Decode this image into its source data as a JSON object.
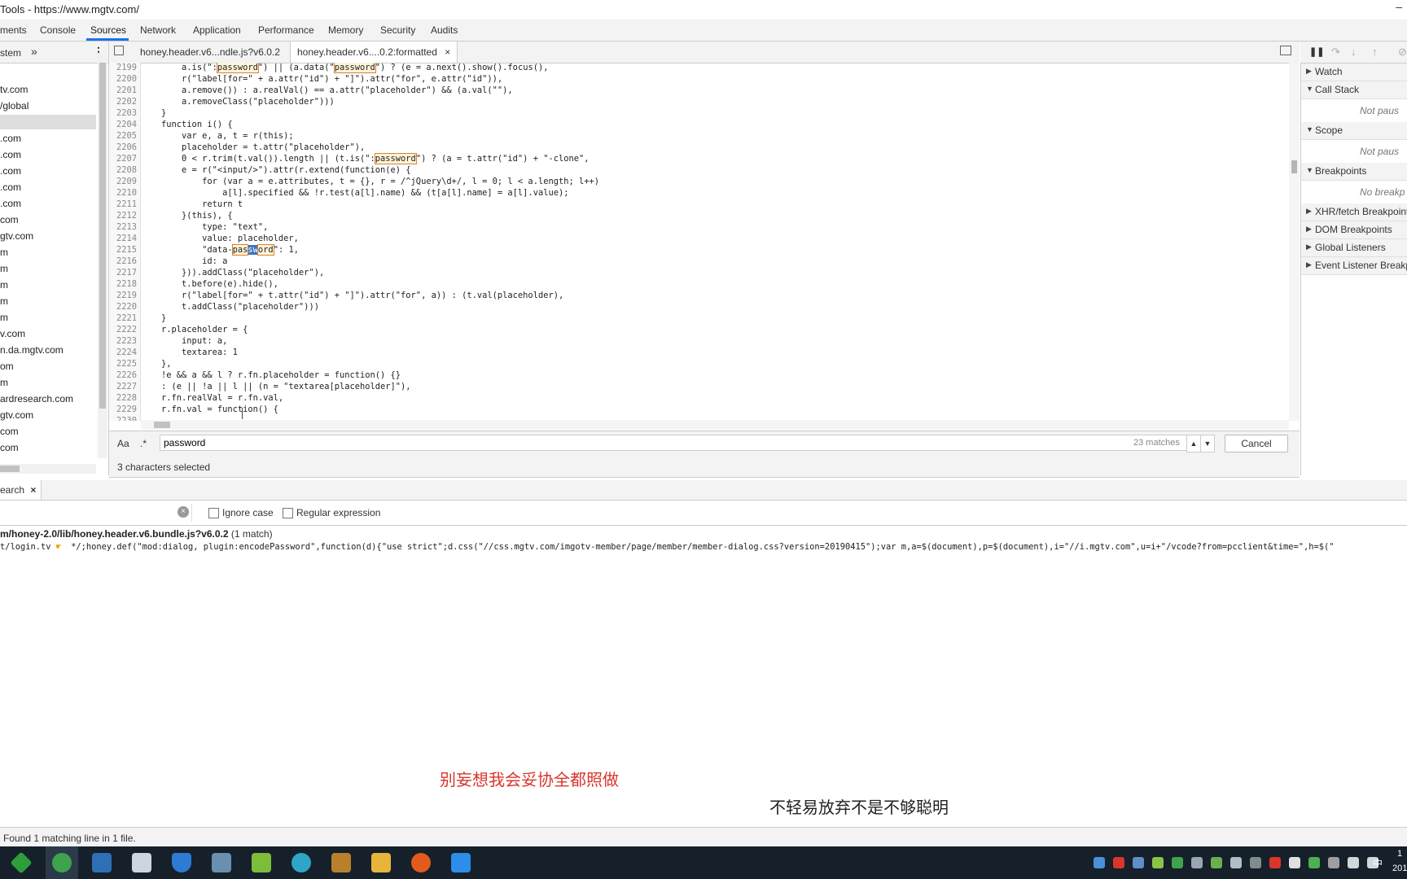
{
  "window": {
    "title": "Tools - https://www.mgtv.com/"
  },
  "panel_tabs": [
    {
      "label": "ments"
    },
    {
      "label": "Console"
    },
    {
      "label": "Sources"
    },
    {
      "label": "Network"
    },
    {
      "label": "Application"
    },
    {
      "label": "Performance"
    },
    {
      "label": "Memory"
    },
    {
      "label": "Security"
    },
    {
      "label": "Audits"
    }
  ],
  "navigator": {
    "tab_label": "stem",
    "more_glyph": "»",
    "items": [
      "tv.com",
      "/global",
      "",
      ".com",
      ".com",
      ".com",
      ".com",
      ".com",
      "com",
      "gtv.com",
      "m",
      "m",
      "m",
      "m",
      "m",
      "v.com",
      "n.da.mgtv.com",
      "om",
      "m",
      "ardresearch.com",
      "gtv.com",
      "com",
      "com"
    ]
  },
  "editor": {
    "tabs": [
      {
        "label": "honey.header.v6...ndle.js?v6.0.2"
      },
      {
        "label": "honey.header.v6....0.2:formatted",
        "close": "×"
      }
    ],
    "lines": [
      {
        "n": "2199",
        "segs": [
          {
            "t": "        a.is(\":"
          },
          {
            "t": "password",
            "h": "hl"
          },
          {
            "t": "\") || (a.data(\""
          },
          {
            "t": "password",
            "h": "hl"
          },
          {
            "t": "\") ? (e = a.next().show().focus(),"
          }
        ]
      },
      {
        "n": "2200",
        "segs": [
          {
            "t": "        r(\"label[for=\" + a.attr(\"id\") + \"]\").attr(\"for\", e.attr(\"id\")),"
          }
        ]
      },
      {
        "n": "2201",
        "segs": [
          {
            "t": "        a.remove()) : a.realVal() == a.attr(\"placeholder\") && (a.val(\"\"),"
          }
        ]
      },
      {
        "n": "2202",
        "segs": [
          {
            "t": "        a.removeClass(\"placeholder\")))"
          }
        ]
      },
      {
        "n": "2203",
        "segs": [
          {
            "t": "    }"
          }
        ]
      },
      {
        "n": "2204",
        "segs": [
          {
            "t": "    function i() {"
          }
        ]
      },
      {
        "n": "2205",
        "segs": [
          {
            "t": "        var e, a, t = r(this);"
          }
        ]
      },
      {
        "n": "2206",
        "segs": [
          {
            "t": "        placeholder = t.attr(\"placeholder\"),"
          }
        ]
      },
      {
        "n": "2207",
        "segs": [
          {
            "t": "        0 < r.trim(t.val()).length || (t.is(\":"
          },
          {
            "t": "password",
            "h": "hl"
          },
          {
            "t": "\") ? (a = t.attr(\"id\") + \"-clone\","
          }
        ]
      },
      {
        "n": "2208",
        "segs": [
          {
            "t": "        e = r(\"<input/>\").attr(r.extend(function(e) {"
          }
        ]
      },
      {
        "n": "2209",
        "segs": [
          {
            "t": "            for (var a = e.attributes, t = {}, r = /^jQuery\\d+/, l = 0; l < a.length; l++)"
          }
        ]
      },
      {
        "n": "2210",
        "segs": [
          {
            "t": "                a[l].specified && !r.test(a[l].name) && (t[a[l].name] = a[l].value);"
          }
        ]
      },
      {
        "n": "2211",
        "segs": [
          {
            "t": "            return t"
          }
        ]
      },
      {
        "n": "2212",
        "segs": [
          {
            "t": "        }(this), {"
          }
        ]
      },
      {
        "n": "2213",
        "segs": [
          {
            "t": "            type: \"text\","
          }
        ]
      },
      {
        "n": "2214",
        "segs": [
          {
            "t": "            value: placeholder,"
          }
        ]
      },
      {
        "n": "2215",
        "segs": [
          {
            "t": "            \"data-"
          },
          {
            "t": "pas",
            "h": "hl"
          },
          {
            "t": "sw",
            "h": "hlsel"
          },
          {
            "t": "ord",
            "h": "hl"
          },
          {
            "t": "\": 1,"
          }
        ]
      },
      {
        "n": "2216",
        "segs": [
          {
            "t": "            id: a"
          }
        ]
      },
      {
        "n": "2217",
        "segs": [
          {
            "t": "        })).addClass(\"placeholder\"),"
          }
        ]
      },
      {
        "n": "2218",
        "segs": [
          {
            "t": "        t.before(e).hide(),"
          }
        ]
      },
      {
        "n": "2219",
        "segs": [
          {
            "t": "        r(\"label[for=\" + t.attr(\"id\") + \"]\").attr(\"for\", a)) : (t.val(placeholder),"
          }
        ]
      },
      {
        "n": "2220",
        "segs": [
          {
            "t": "        t.addClass(\"placeholder\")))"
          }
        ]
      },
      {
        "n": "2221",
        "segs": [
          {
            "t": "    }"
          }
        ]
      },
      {
        "n": "2222",
        "segs": [
          {
            "t": "    r.placeholder = {"
          }
        ]
      },
      {
        "n": "2223",
        "segs": [
          {
            "t": "        input: a,"
          }
        ]
      },
      {
        "n": "2224",
        "segs": [
          {
            "t": "        textarea: 1"
          }
        ]
      },
      {
        "n": "2225",
        "segs": [
          {
            "t": "    },"
          }
        ]
      },
      {
        "n": "2226",
        "segs": [
          {
            "t": "    !e && a && l ? r.fn.placeholder = function() {}"
          }
        ]
      },
      {
        "n": "2227",
        "segs": [
          {
            "t": "    : (e || !a || l || (n = \"textarea[placeholder]\"),"
          }
        ]
      },
      {
        "n": "2228",
        "segs": [
          {
            "t": "    r.fn.realVal = r.fn.val,"
          }
        ]
      },
      {
        "n": "2229",
        "segs": [
          {
            "t": "    r.fn.val = function() {"
          }
        ]
      },
      {
        "n": "2230",
        "segs": [
          {
            "t": ""
          }
        ]
      }
    ]
  },
  "find": {
    "case_label": "Aa",
    "regex_label": ".*",
    "value": "password",
    "matches": "23 matches",
    "cancel_label": "Cancel",
    "up_glyph": "▲",
    "down_glyph": "▼"
  },
  "editor_status": "3 characters selected",
  "debugger": {
    "panes": [
      {
        "label": "Watch",
        "state": "collapsed"
      },
      {
        "label": "Call Stack",
        "state": "expanded",
        "body": "Not paus"
      },
      {
        "label": "Scope",
        "state": "expanded",
        "body": "Not paus"
      },
      {
        "label": "Breakpoints",
        "state": "expanded",
        "body": "No breakp"
      },
      {
        "label": "XHR/fetch Breakpoint",
        "state": "collapsed"
      },
      {
        "label": "DOM Breakpoints",
        "state": "collapsed"
      },
      {
        "label": "Global Listeners",
        "state": "collapsed"
      },
      {
        "label": "Event Listener Breakp",
        "state": "collapsed"
      }
    ]
  },
  "drawer": {
    "tab_label": "earch",
    "tab_close": "×",
    "ignore_case_label": "Ignore case",
    "regex_label": "Regular expression",
    "result_file": "m/honey-2.0/lib/honey.header.v6.bundle.js?v6.0.2",
    "result_count": "(1 match)",
    "result_line_prefix": "t/login.tv",
    "result_line": "*/;honey.def(\"mod:dialog, plugin:encodePassword\",function(d){\"use strict\";d.css(\"//css.mgtv.com/imgotv-member/page/member/member-dialog.css?version=20190415\");var m,a=$(document),p=$(document),i=\"//i.mgtv.com\",u=i+\"/vcode?from=pcclient&time=\",h=$(\"",
    "status": "Found 1 matching line in 1 file."
  },
  "subtitles": {
    "line1": "别妄想我会妥协全都照做",
    "line2": "不轻易放弃不是不够聪明"
  },
  "taskbar": {
    "clock_time": "1",
    "clock_date": "201",
    "ime": "中",
    "icons": [
      "start-arrow-icon",
      "browser-icon",
      "e-app-icon",
      "window-app-icon",
      "shield-app-icon",
      "weather-app-icon",
      "notepad-app-icon",
      "globe-app-icon",
      "media-app-icon",
      "folder-icon",
      "sunglasses-app-icon",
      "w-app-icon"
    ]
  },
  "colors": {
    "accent": "#1a73e8",
    "match_outline": "#d4813a",
    "selection": "#3a75c4",
    "subtitle_red": "#d9362b",
    "taskbar": "#15202b"
  }
}
